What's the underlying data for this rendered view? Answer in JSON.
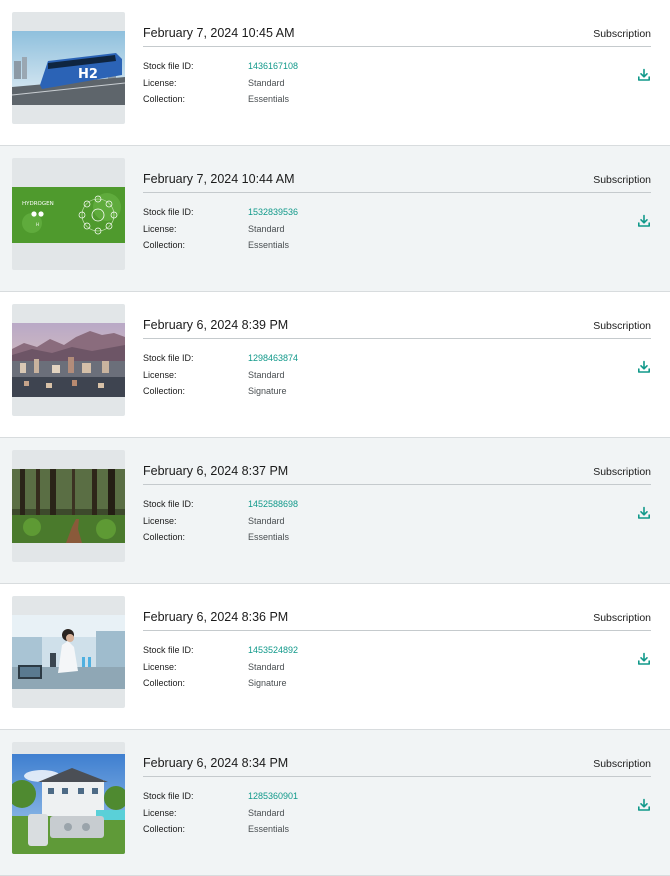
{
  "labels": {
    "stock_id": "Stock file ID:",
    "license": "License:",
    "collection": "Collection:"
  },
  "colors": {
    "accent": "#11998a",
    "alt_row": "#f1f4f5"
  },
  "items": [
    {
      "date": "February 7, 2024 10:45 AM",
      "type": "Subscription",
      "stock_id": "1436167108",
      "license": "Standard",
      "collection": "Essentials",
      "thumb": "hydrogen-tram",
      "thumb_text": ""
    },
    {
      "date": "February 7, 2024 10:44 AM",
      "type": "Subscription",
      "stock_id": "1532839536",
      "license": "Standard",
      "collection": "Essentials",
      "thumb": "hydrogen-green",
      "thumb_text": "HYDROGEN"
    },
    {
      "date": "February 6, 2024 8:39 PM",
      "type": "Subscription",
      "stock_id": "1298463874",
      "license": "Standard",
      "collection": "Signature",
      "thumb": "city-mountains",
      "thumb_text": ""
    },
    {
      "date": "February 6, 2024 8:37 PM",
      "type": "Subscription",
      "stock_id": "1452588698",
      "license": "Standard",
      "collection": "Essentials",
      "thumb": "forest-path",
      "thumb_text": ""
    },
    {
      "date": "February 6, 2024 8:36 PM",
      "type": "Subscription",
      "stock_id": "1453524892",
      "license": "Standard",
      "collection": "Signature",
      "thumb": "lab-scientist",
      "thumb_text": ""
    },
    {
      "date": "February 6, 2024 8:34 PM",
      "type": "Subscription",
      "stock_id": "1285360901",
      "license": "Standard",
      "collection": "Essentials",
      "thumb": "house-tanks",
      "thumb_text": ""
    }
  ]
}
